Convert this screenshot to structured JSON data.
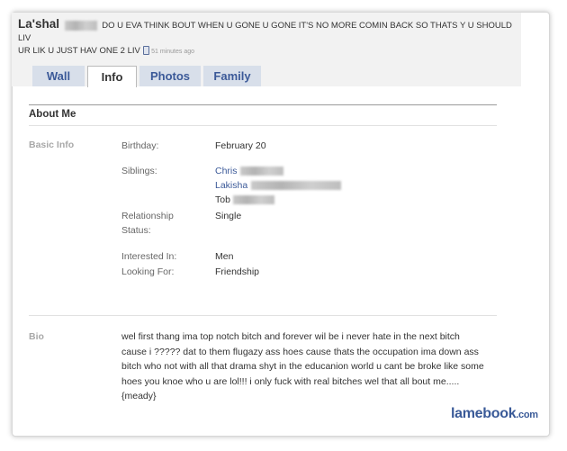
{
  "status": {
    "name": "La'shal",
    "text_line1": "DO U EVA THINK BOUT WHEN U GONE U GONE IT'S NO MORE COMIN BACK SO THATS Y U SHOULD LIV",
    "text_line2": "UR LIK U JUST HAV ONE 2 LIV",
    "time": "51 minutes ago"
  },
  "tabs": [
    {
      "label": "Wall",
      "active": false
    },
    {
      "label": "Info",
      "active": true
    },
    {
      "label": "Photos",
      "active": false
    },
    {
      "label": "Family",
      "active": false
    }
  ],
  "about": {
    "title": "About Me",
    "basic_info_label": "Basic Info",
    "birthday_label": "Birthday:",
    "birthday": "February 20",
    "siblings_label": "Siblings:",
    "siblings": [
      "Chris",
      "Lakisha",
      "Tob"
    ],
    "relationship_label": "Relationship",
    "relationship_label2": "Status:",
    "relationship": "Single",
    "interested_label": "Interested In:",
    "interested": "Men",
    "looking_label": "Looking For:",
    "looking": "Friendship",
    "bio_label": "Bio",
    "bio_lines": [
      "wel first thang ima top notch bitch and forever wil be i never hate in the next bitch",
      "cause i ????? dat to them flugazy ass hoes cause thats the occupation ima down ass",
      "bitch who not with all that drama shyt in the educanion world u cant be broke like some",
      "hoes you knoe who u are lol!!! i only fuck with real bitches wel that all bout me.....",
      "{meady}"
    ]
  },
  "watermark": {
    "main": "lamebook",
    "suffix": ".com"
  }
}
